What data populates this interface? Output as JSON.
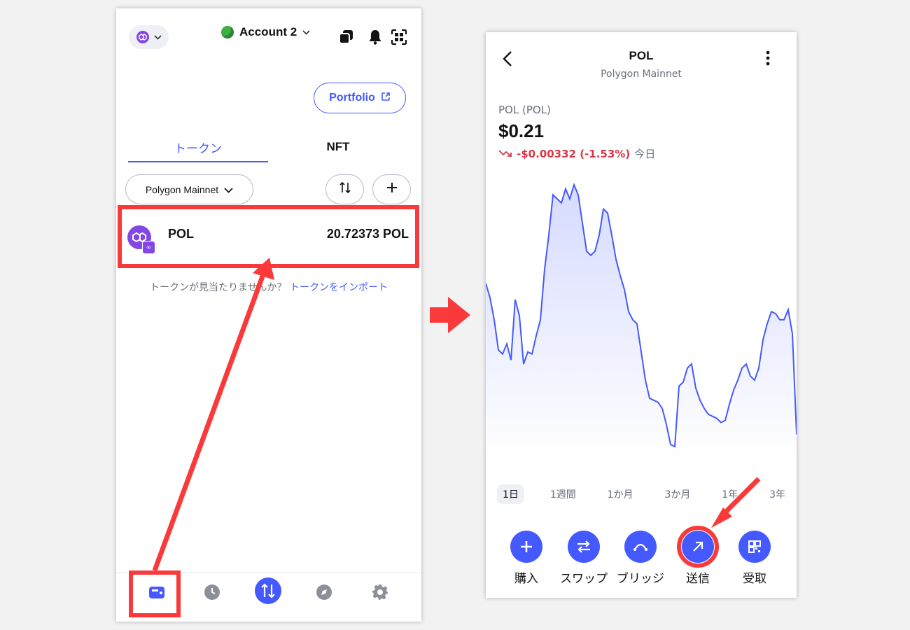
{
  "left": {
    "header": {
      "network_icon": "polygon-icon",
      "account_name": "Account 2",
      "icons": [
        "copy-icon",
        "bell-icon",
        "qr-scan-icon"
      ]
    },
    "portfolio_label": "Portfolio",
    "tabs": [
      {
        "label": "トークン",
        "active": true
      },
      {
        "label": "NFT",
        "active": false
      }
    ],
    "network_filter": "Polygon Mainnet",
    "tokens": [
      {
        "name": "POL",
        "balance": "20.72373 POL",
        "icon": "polygon-icon"
      }
    ],
    "import_prompt": "トークンが見当たりませんか？",
    "import_link": "トークンをインポート",
    "nav": [
      "wallet-icon",
      "clock-icon",
      "swap-arrows-icon",
      "compass-icon",
      "gear-icon"
    ]
  },
  "right": {
    "title": "POL",
    "subtitle": "Polygon Mainnet",
    "asset_name": "POL (POL)",
    "price": "$0.21",
    "change": "-$0.00332 (-1.53%)",
    "change_period": "今日",
    "periods": [
      "1日",
      "1週間",
      "1か月",
      "3か月",
      "1年",
      "3年"
    ],
    "active_period": "1日",
    "actions": [
      {
        "label": "購入",
        "icon": "plus-icon"
      },
      {
        "label": "スワップ",
        "icon": "swap-icon"
      },
      {
        "label": "ブリッジ",
        "icon": "bridge-icon"
      },
      {
        "label": "送信",
        "icon": "send-arrow-icon"
      },
      {
        "label": "受取",
        "icon": "qr-icon"
      }
    ],
    "price_series": [
      0.2138,
      0.2131,
      0.212,
      0.2105,
      0.2103,
      0.2108,
      0.21,
      0.213,
      0.2122,
      0.2098,
      0.2104,
      0.2103,
      0.2112,
      0.212,
      0.2145,
      0.2162,
      0.2182,
      0.218,
      0.2178,
      0.2185,
      0.218,
      0.2187,
      0.2182,
      0.2168,
      0.2154,
      0.2152,
      0.2154,
      0.2162,
      0.2175,
      0.2173,
      0.2162,
      0.215,
      0.2142,
      0.2135,
      0.2124,
      0.212,
      0.2118,
      0.2104,
      0.209,
      0.2081,
      0.208,
      0.2079,
      0.2076,
      0.2068,
      0.2058,
      0.2057,
      0.2087,
      0.2089,
      0.2096,
      0.2098,
      0.2086,
      0.208,
      0.2076,
      0.2073,
      0.2072,
      0.2071,
      0.2069,
      0.207,
      0.2078,
      0.2085,
      0.209,
      0.2096,
      0.2098,
      0.2092,
      0.209,
      0.2096,
      0.211,
      0.2118,
      0.2124,
      0.2123,
      0.212,
      0.212,
      0.2125,
      0.2113,
      0.2063
    ],
    "accent_color": "#4459ff",
    "down_color": "#d73847"
  }
}
